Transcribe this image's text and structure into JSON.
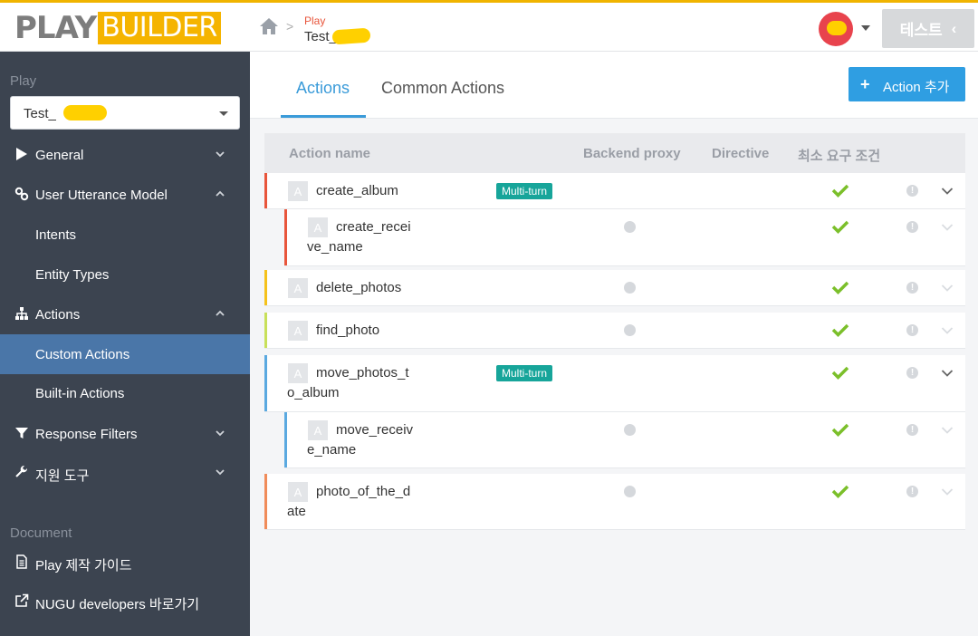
{
  "header": {
    "logo_play": "PLAY",
    "logo_builder": "BUILDER",
    "breadcrumb_top": "Play",
    "breadcrumb_bottom": "Test_",
    "test_button": "테스트"
  },
  "sidebar": {
    "play_section": "Play",
    "play_select_value": "Test_",
    "items": [
      {
        "label": "General",
        "icon": "play-icon",
        "expanded": false
      },
      {
        "label": "User Utterance Model",
        "icon": "link-icon",
        "expanded": true
      },
      {
        "label": "Intents"
      },
      {
        "label": "Entity Types"
      },
      {
        "label": "Actions",
        "icon": "sitemap-icon",
        "expanded": true
      },
      {
        "label": "Custom Actions",
        "active": true
      },
      {
        "label": "Built-in Actions"
      },
      {
        "label": "Response Filters",
        "icon": "filter-icon",
        "expanded": false
      },
      {
        "label": "지원 도구",
        "icon": "wrench-icon",
        "expanded": false
      }
    ],
    "document_section": "Document",
    "doc_items": [
      {
        "label": "Play 제작 가이드",
        "icon": "document-icon"
      },
      {
        "label": "NUGU developers 바로가기",
        "icon": "external-link-icon"
      }
    ]
  },
  "main": {
    "tabs": [
      {
        "label": "Actions",
        "active": true
      },
      {
        "label": "Common Actions",
        "active": false
      }
    ],
    "add_button": "Action 추가",
    "columns": [
      "Action name",
      "Backend proxy",
      "Directive",
      "최소 요구 조건"
    ],
    "badge_letter": "A",
    "multiturn_label": "Multi-turn",
    "rows": [
      {
        "name": "create_album",
        "multiturn": true,
        "proxy": false,
        "check": true,
        "color": "#e8553b",
        "chev": "dark"
      },
      {
        "name": "create_receive_name",
        "name_l1": "create_recei",
        "name_l2": "ve_name",
        "child": true,
        "proxy": true,
        "check": true,
        "color": "#e8553b",
        "chev": "light"
      },
      {
        "name": "delete_photos",
        "proxy": true,
        "check": true,
        "color": "#f5c21b",
        "chev": "light"
      },
      {
        "name": "find_photo",
        "proxy": true,
        "check": true,
        "color": "#c8e05a",
        "chev": "light"
      },
      {
        "name": "move_photos_to_album",
        "name_l1": "move_photos_t",
        "name_l2": "o_album",
        "multiturn": true,
        "proxy": false,
        "check": true,
        "color": "#5aa9e0",
        "chev": "dark"
      },
      {
        "name": "move_receive_name",
        "name_l1": "move_receiv",
        "name_l2": "e_name",
        "child": true,
        "proxy": true,
        "check": true,
        "color": "#5aa9e0",
        "chev": "light"
      },
      {
        "name": "photo_of_the_date",
        "name_l1": "photo_of_the_d",
        "name_l2": "ate",
        "proxy": true,
        "check": true,
        "color": "#f08c5a",
        "chev": "light"
      }
    ]
  },
  "colors": {
    "sidebar_bg": "#3c4450",
    "active_nav": "#4a76a8",
    "accent_blue": "#2f9ee2",
    "logo_yellow": "#f5b400",
    "multiturn_teal": "#17a59a",
    "check_green": "#7bbf2a"
  }
}
